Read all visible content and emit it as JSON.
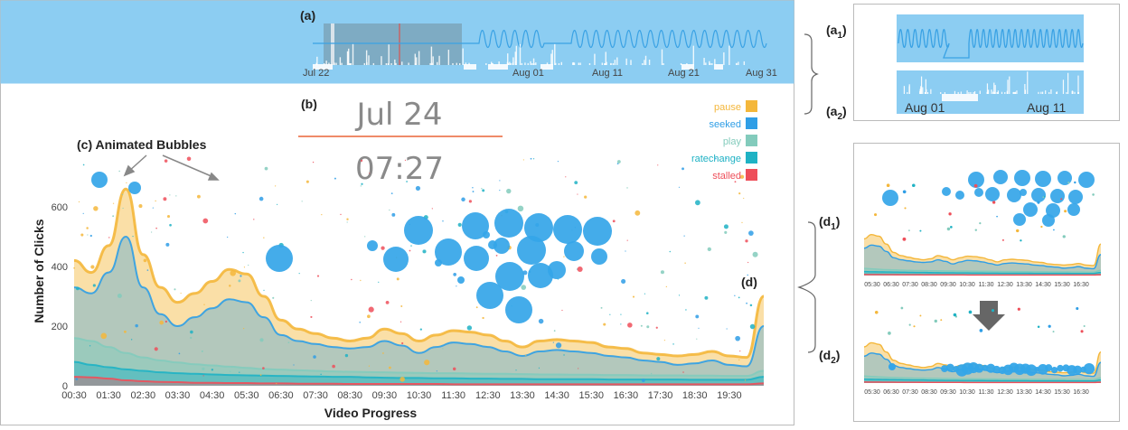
{
  "colors": {
    "topbar": "#8ccdf2",
    "wave": "#3aa2e4",
    "pause": "#f4b73b",
    "seeked": "#2f9ee6",
    "play": "#83cbbc",
    "ratechange": "#1fb2c4",
    "stalled": "#ee4f5a",
    "date_rule": "#ef8b69",
    "bubble": "#34a5e8"
  },
  "labels": {
    "a": "(a)",
    "b": "(b)",
    "c": "(c) Animated Bubbles",
    "d": "(d)",
    "a1_pre": "(a",
    "a1_sub": "1",
    "a1_post": ")",
    "a2_pre": "(a",
    "a2_sub": "2",
    "a2_post": ")",
    "d1_pre": "(d",
    "d1_sub": "1",
    "d1_post": ")",
    "d2_pre": "(d",
    "d2_sub": "2",
    "d2_post": ")"
  },
  "timeline": {
    "date_ticks": [
      "Jul 22",
      "Aug 01",
      "Aug 11",
      "Aug 21",
      "Aug 31"
    ],
    "zoom_ticks": [
      "Aug 01",
      "Aug 11"
    ]
  },
  "clock": {
    "date": "Jul 24",
    "time": "07:27"
  },
  "chart_data": {
    "type": "area",
    "xlabel": "Video Progress",
    "ylabel": "Number of Clicks",
    "ylim": [
      0,
      900
    ],
    "yticks": [
      0,
      200,
      400,
      600
    ],
    "legend_position": "top-right",
    "categories": [
      "00:30",
      "01:30",
      "02:30",
      "03:30",
      "04:30",
      "05:30",
      "06:30",
      "07:30",
      "08:30",
      "09:30",
      "10:30",
      "11:30",
      "12:30",
      "13:30",
      "14:30",
      "15:30",
      "16:30",
      "17:30",
      "18:30",
      "19:30"
    ],
    "x_knots": [
      0,
      0.5,
      1,
      1.5,
      2,
      2.5,
      3,
      3.5,
      4,
      4.5,
      5,
      5.5,
      6,
      6.5,
      7,
      7.5,
      8,
      8.5,
      9,
      9.5,
      10,
      10.5,
      11,
      11.5,
      12,
      12.5,
      13,
      13.5,
      14,
      14.5,
      15,
      15.5,
      16,
      16.5,
      17,
      17.5,
      18,
      18.5,
      19,
      19.5,
      20
    ],
    "series": [
      {
        "name": "stalled",
        "values": [
          30,
          28,
          24,
          18,
          15,
          13,
          12,
          10,
          10,
          9,
          9,
          8,
          8,
          7,
          7,
          7,
          6,
          6,
          6,
          6,
          6,
          6,
          5,
          5,
          5,
          5,
          5,
          5,
          5,
          5,
          5,
          5,
          5,
          5,
          5,
          5,
          5,
          5,
          5,
          5,
          8
        ]
      },
      {
        "name": "ratechange",
        "values": [
          80,
          70,
          62,
          55,
          50,
          45,
          42,
          40,
          38,
          36,
          35,
          34,
          33,
          32,
          31,
          30,
          30,
          28,
          27,
          26,
          26,
          25,
          25,
          24,
          24,
          23,
          23,
          22,
          22,
          22,
          22,
          21,
          21,
          21,
          21,
          21,
          20,
          20,
          20,
          20,
          30
        ]
      },
      {
        "name": "play",
        "values": [
          160,
          150,
          130,
          110,
          95,
          85,
          78,
          72,
          68,
          64,
          60,
          56,
          54,
          52,
          50,
          48,
          47,
          46,
          45,
          44,
          43,
          42,
          42,
          41,
          40,
          40,
          39,
          38,
          38,
          37,
          37,
          36,
          36,
          35,
          35,
          35,
          34,
          34,
          33,
          33,
          50
        ]
      },
      {
        "name": "seeked",
        "values": [
          330,
          310,
          380,
          500,
          330,
          240,
          200,
          230,
          260,
          290,
          280,
          230,
          170,
          150,
          140,
          130,
          125,
          130,
          150,
          135,
          110,
          130,
          145,
          140,
          130,
          115,
          100,
          115,
          120,
          115,
          110,
          100,
          95,
          85,
          80,
          70,
          75,
          85,
          70,
          65,
          200
        ]
      },
      {
        "name": "pause",
        "values": [
          420,
          380,
          470,
          660,
          440,
          330,
          280,
          310,
          350,
          390,
          375,
          300,
          220,
          190,
          175,
          160,
          150,
          160,
          190,
          175,
          150,
          170,
          185,
          180,
          170,
          150,
          130,
          150,
          155,
          150,
          145,
          130,
          125,
          110,
          105,
          100,
          105,
          115,
          100,
          95,
          300
        ]
      }
    ],
    "legend": [
      "pause",
      "seeked",
      "play",
      "ratechange",
      "stalled"
    ]
  },
  "side_d1": {
    "ticks": [
      "05:30",
      "06:30",
      "07:30",
      "08:30",
      "09:30",
      "10:30",
      "11:30",
      "12:30",
      "13:30",
      "14:30",
      "15:30",
      "16:30"
    ]
  },
  "side_d2": {
    "ticks": [
      "05:30",
      "06:30",
      "07:30",
      "08:30",
      "09:30",
      "10:30",
      "11:30",
      "12:30",
      "13:30",
      "14:30",
      "15:30",
      "16:30"
    ]
  }
}
